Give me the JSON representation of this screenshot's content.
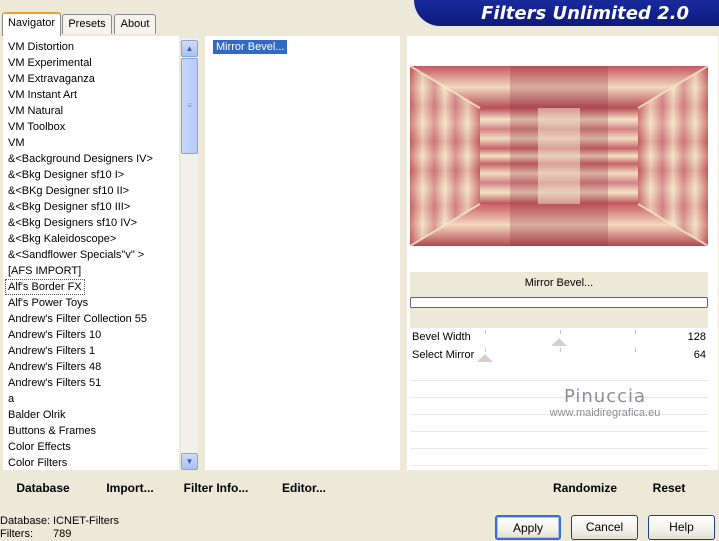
{
  "tabs": [
    "Navigator",
    "Presets",
    "About"
  ],
  "banner": "Filters Unlimited 2.0",
  "categories": [
    "VM Distortion",
    "VM Experimental",
    "VM Extravaganza",
    "VM Instant Art",
    "VM Natural",
    "VM Toolbox",
    "VM",
    "&<Background Designers IV>",
    "&<Bkg Designer sf10 I>",
    "&<BKg Designer sf10 II>",
    "&<Bkg Designer sf10 III>",
    "&<Bkg Designers sf10 IV>",
    "&<Bkg Kaleidoscope>",
    "&<Sandflower Specials\"v\" >",
    "[AFS IMPORT]",
    "Alf's Border FX",
    "Alf's Power Toys",
    "Andrew's Filter Collection 55",
    "Andrew's Filters 10",
    "Andrew's Filters 1",
    "Andrew's Filters 48",
    "Andrew's Filters 51",
    "a",
    "Balder Olrik",
    "Buttons & Frames",
    "Color Effects",
    "Color Filters"
  ],
  "selected_category": "Alf's Border FX",
  "filters": [
    "Mirror Bevel..."
  ],
  "preview_title": "Mirror Bevel...",
  "progress": 0,
  "sliders": [
    {
      "label": "Bevel Width",
      "value": "128",
      "level": 0.5
    },
    {
      "label": "Select Mirror",
      "value": "64",
      "level": 0.25
    }
  ],
  "watermark": {
    "name": "Pinuccia",
    "url": "www.maidiregrafica.eu"
  },
  "toolbar": {
    "database": "Database",
    "import": "Import...",
    "filter_info": "Filter Info...",
    "editor": "Editor...",
    "randomize": "Randomize",
    "reset": "Reset"
  },
  "info": {
    "database_label": "Database:",
    "database_value": "ICNET-Filters",
    "filters_label": "Filters:",
    "filters_value": "789"
  },
  "dialog": {
    "apply": "Apply",
    "cancel": "Cancel",
    "help": "Help"
  },
  "colors": {
    "banner": "#0c1a7a",
    "selection": "#316ac5",
    "default_button_border": "#3c6ad8"
  }
}
